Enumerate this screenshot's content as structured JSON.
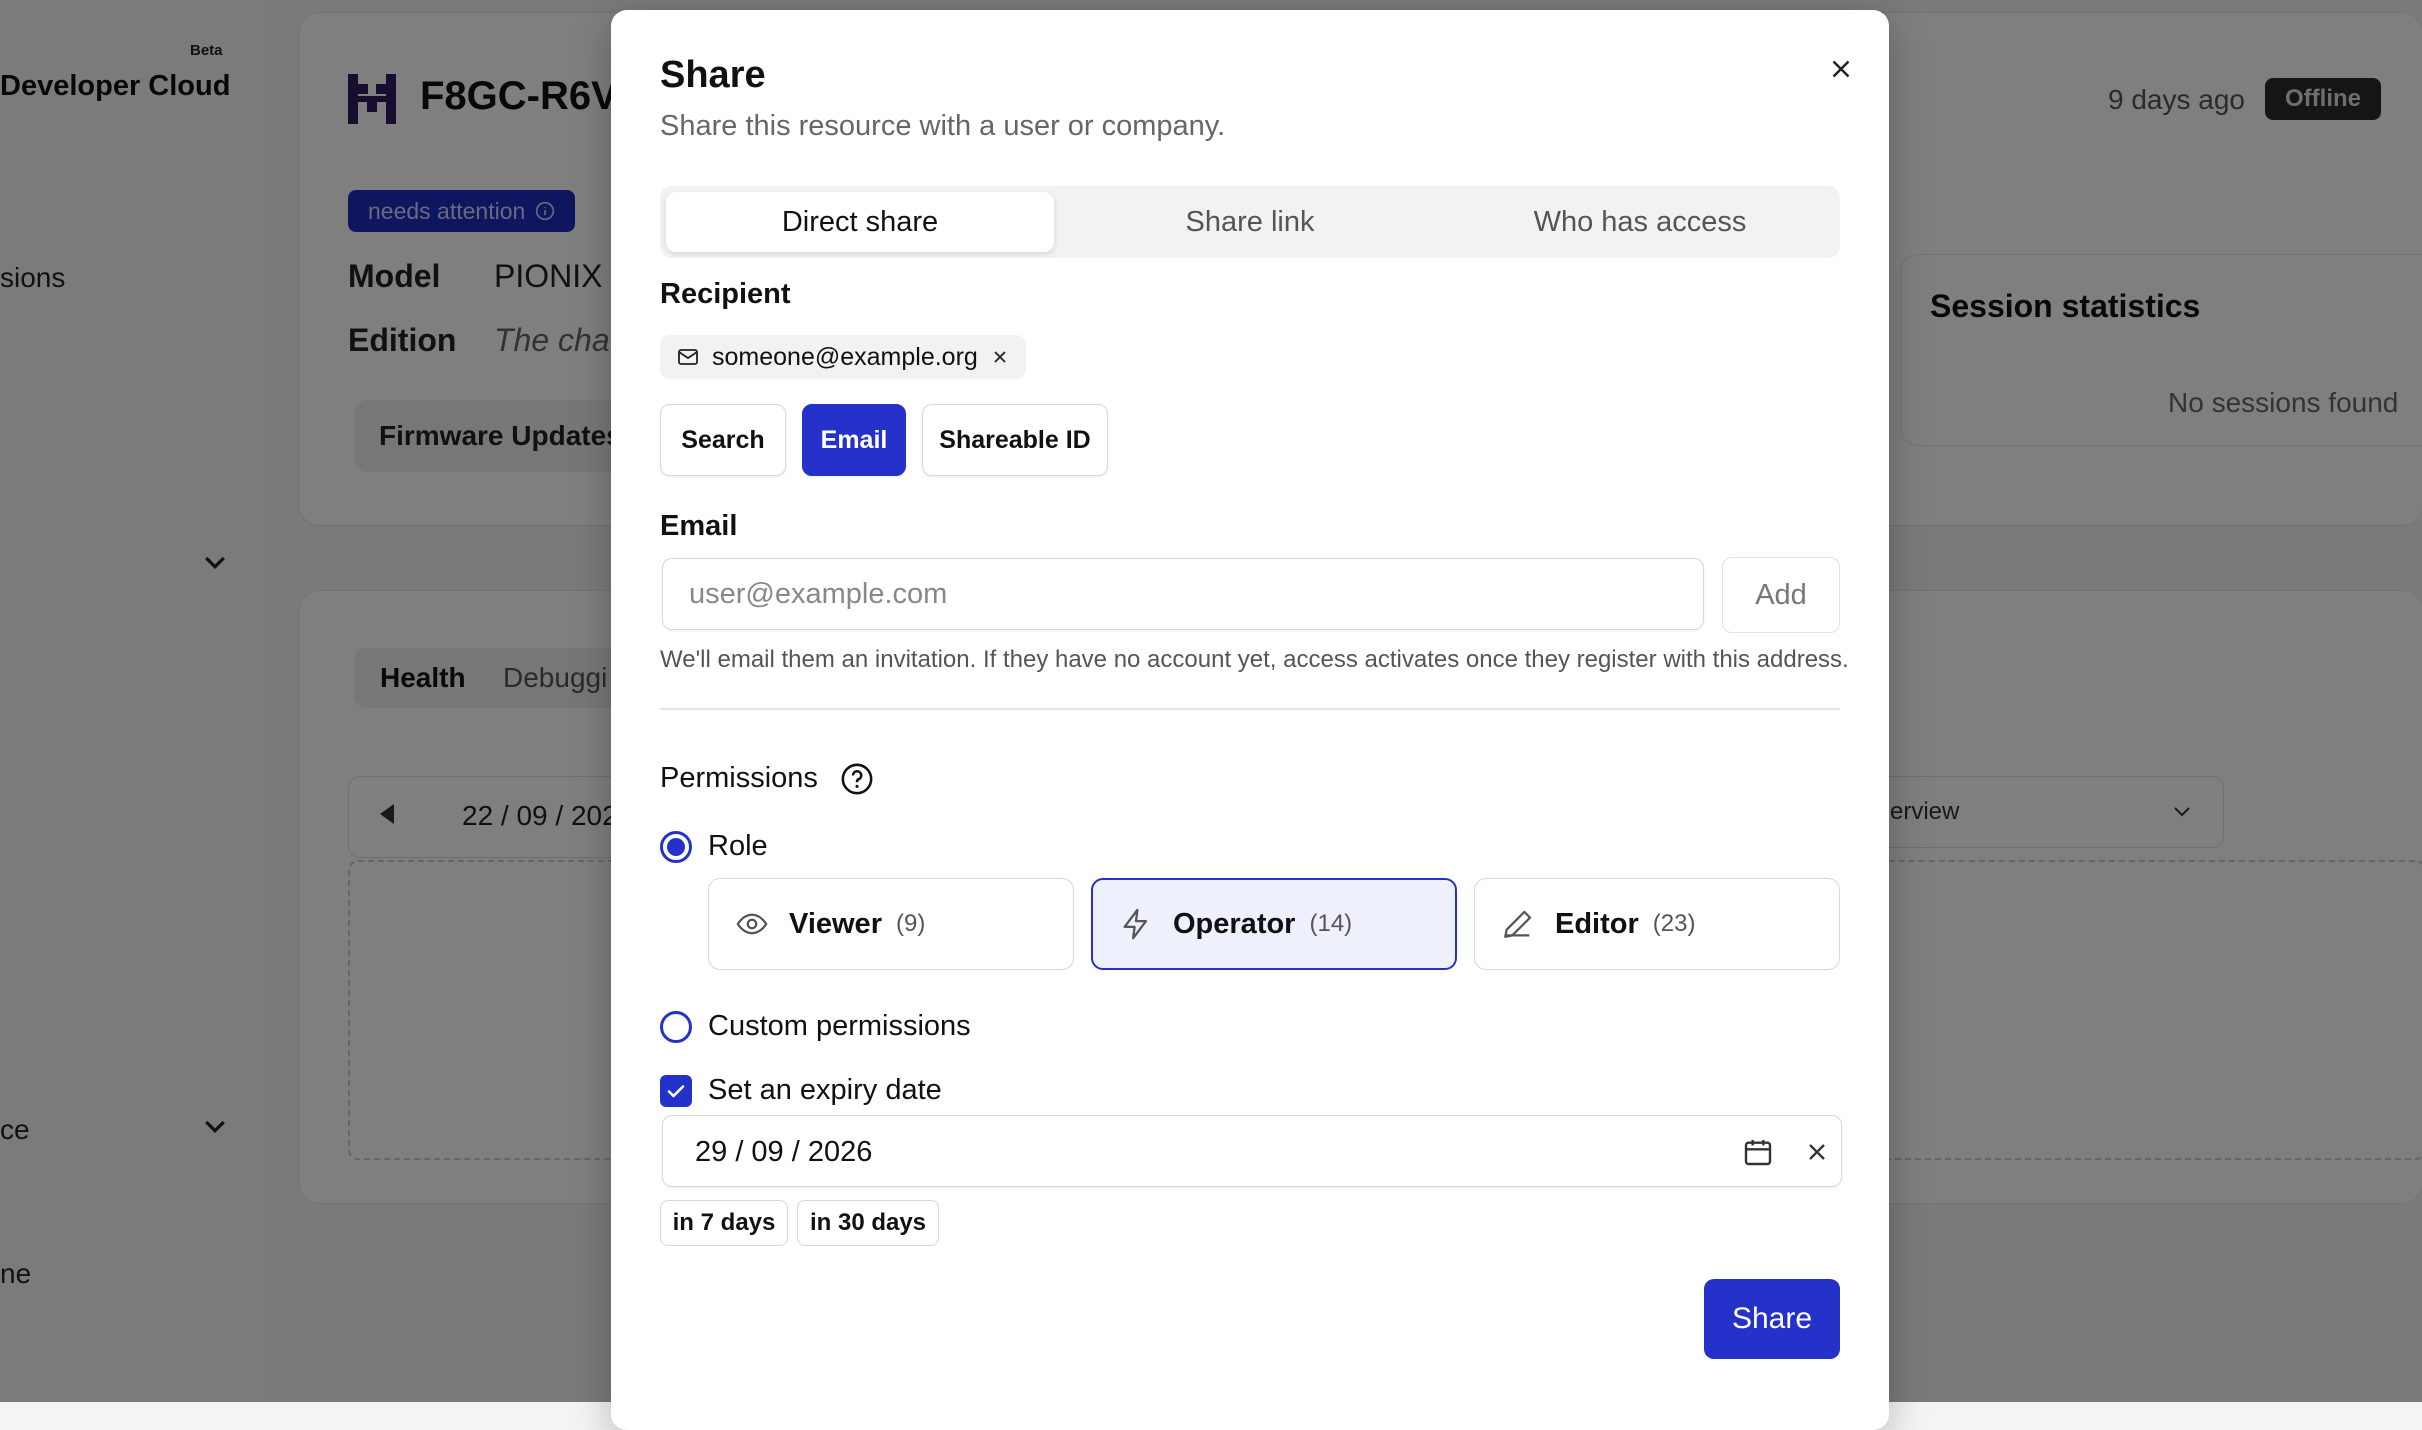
{
  "background": {
    "sidebar": {
      "brand": "Developer Cloud",
      "beta": "Beta",
      "items": [
        "sions",
        "ce",
        "ne"
      ]
    },
    "device": {
      "title": "F8GC-R6V",
      "last_seen": "9 days ago",
      "status": "Offline",
      "badge": "needs attention",
      "model_label": "Model",
      "model_value": "PIONIX V",
      "edition_label": "Edition",
      "edition_value": "The cha",
      "firmware_button": "Firmware Updates"
    },
    "session_stats": {
      "title": "Session statistics",
      "empty": "No sessions found"
    },
    "tabs": [
      "Health",
      "Debuggi"
    ],
    "date": "22 / 09 / 202",
    "overview": "erview"
  },
  "modal": {
    "title": "Share",
    "subtitle": "Share this resource with a user or company.",
    "tabs": [
      {
        "label": "Direct share",
        "active": true
      },
      {
        "label": "Share link",
        "active": false
      },
      {
        "label": "Who has access",
        "active": false
      }
    ],
    "recipient": {
      "label": "Recipient",
      "chip": "someone@example.org",
      "modes": [
        {
          "label": "Search",
          "active": false
        },
        {
          "label": "Email",
          "active": true
        },
        {
          "label": "Shareable ID",
          "active": false
        }
      ]
    },
    "email": {
      "label": "Email",
      "placeholder": "user@example.com",
      "add_label": "Add",
      "hint": "We'll email them an invitation. If they have no account yet, access activates once they register with this address."
    },
    "permissions": {
      "label": "Permissions",
      "role_label": "Role",
      "roles": [
        {
          "name": "Viewer",
          "count": "(9)",
          "icon": "eye-icon",
          "active": false
        },
        {
          "name": "Operator",
          "count": "(14)",
          "icon": "lightning-icon",
          "active": true
        },
        {
          "name": "Editor",
          "count": "(23)",
          "icon": "pencil-icon",
          "active": false
        }
      ],
      "custom_label": "Custom permissions"
    },
    "expiry": {
      "label": "Set an expiry date",
      "checked": true,
      "date": "29 / 09 / 2026",
      "quick": [
        "in 7 days",
        "in 30 days"
      ]
    },
    "share_label": "Share",
    "colors": {
      "accent": "#2532c9",
      "role_active_bg": "#eef0fc"
    }
  }
}
